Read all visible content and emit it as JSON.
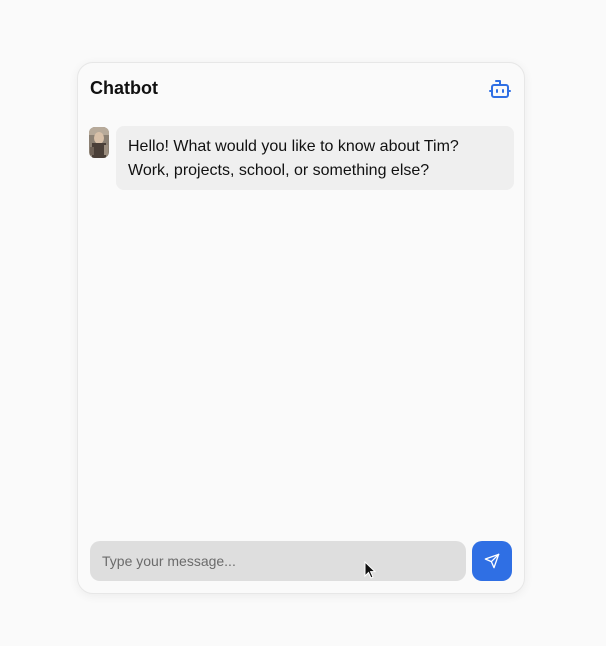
{
  "header": {
    "title": "Chatbot",
    "icon": "bot-icon"
  },
  "messages": [
    {
      "sender": "bot",
      "avatar_icon": "avatar-image",
      "text_line1": "Hello! What would you like to know about Tim?",
      "text_line2": "Work, projects, school, or something else?"
    }
  ],
  "composer": {
    "placeholder": "Type your message...",
    "value": "",
    "send_icon": "send-icon"
  },
  "colors": {
    "accent": "#2f6fe4",
    "bubble": "#efefef",
    "input_bg": "#dedede"
  }
}
